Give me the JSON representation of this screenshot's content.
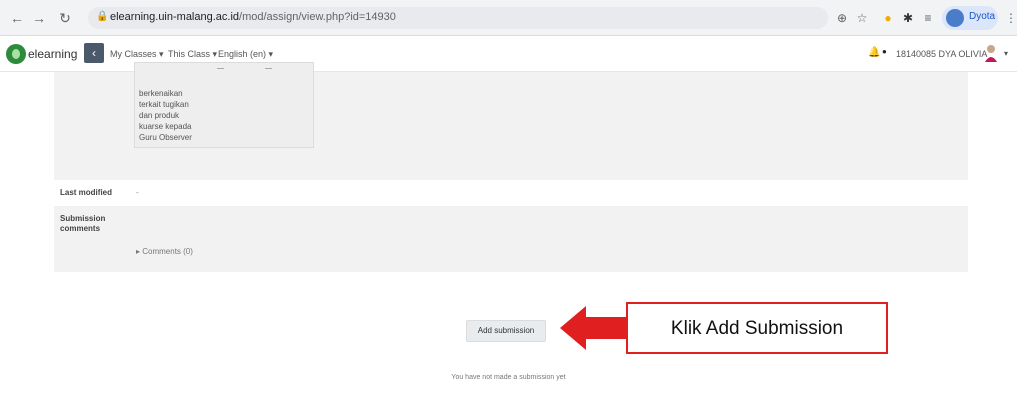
{
  "browser": {
    "url_host": "elearning.uin-malang.ac.id",
    "url_path": "/mod/assign/view.php?id=14930",
    "profile_label": "Dyota"
  },
  "navbar": {
    "site_name": "elearning",
    "menu": [
      "My Classes ▾",
      "This Class ▾",
      "English (en) ▾"
    ],
    "user_name": "18140085 DYA OLIVIA"
  },
  "submission_table": {
    "inner_lines": [
      "berkenaikan",
      "terkait tugikan",
      "dan produk",
      "kuarse kepada",
      "Guru Observer"
    ],
    "last_modified_label": "Last modified",
    "last_modified_value": "-",
    "comments_label_line1": "Submission",
    "comments_label_line2": "comments",
    "comments_link": "▸ Comments (0)"
  },
  "actions": {
    "add_submission_label": "Add submission",
    "no_submission_text": "You have not made a submission yet"
  },
  "annotation": {
    "callout_text": "Klik Add Submission",
    "accent_color": "#e02020"
  }
}
